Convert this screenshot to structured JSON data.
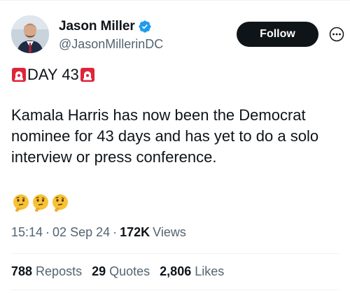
{
  "author": {
    "display_name": "Jason Miller",
    "handle": "@JasonMillerinDC",
    "verified_icon": "verified-badge-icon",
    "avatar_icon": "avatar"
  },
  "actions": {
    "follow_label": "Follow",
    "more_icon": "more-icon"
  },
  "tweet": {
    "day_label": "DAY 43",
    "siren_icon": "siren-icon",
    "text": "Kamala Harris has now been the Democrat nominee for 43 days and has yet to do a solo interview or press conference.",
    "emoji_icons": [
      "thinking-face-icon",
      "thinking-face-icon",
      "thinking-face-icon"
    ]
  },
  "meta": {
    "time": "15:14",
    "date": "02 Sep 24",
    "separator": "·",
    "views_count": "172K",
    "views_label": "Views"
  },
  "stats": {
    "reposts_count": "788",
    "reposts_label": "Reposts",
    "quotes_count": "29",
    "quotes_label": "Quotes",
    "likes_count": "2,806",
    "likes_label": "Likes"
  },
  "colors": {
    "text_primary": "#0f1419",
    "text_secondary": "#536471",
    "verified_blue": "#1d9bf0",
    "divider": "#eff3f4",
    "siren_red": "#e0243a"
  }
}
